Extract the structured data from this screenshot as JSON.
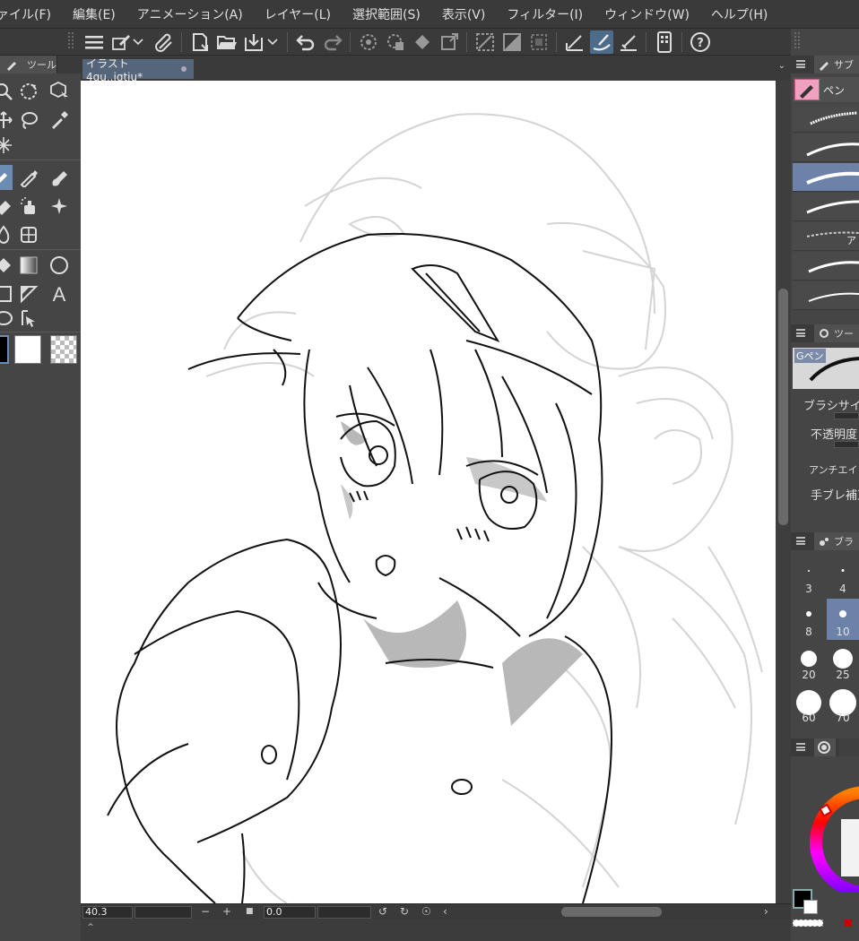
{
  "menu": [
    "ァイル(F)",
    "編集(E)",
    "アニメーション(A)",
    "レイヤー(L)",
    "選択範囲(S)",
    "表示(V)",
    "フィルター(I)",
    "ウィンドウ(W)",
    "ヘルプ(H)"
  ],
  "left_panel": {
    "tab_label": "ツール"
  },
  "document": {
    "tab_title": "イラスト4gu,.jgtju*"
  },
  "status": {
    "zoom": "40.3",
    "rotation": "0.0"
  },
  "right_panel": {
    "subtool_tab": "サブ",
    "subtool_group": "ペン",
    "subtool_partial_label": "ア",
    "tool_property_tab": "ツー",
    "tool_property_name": "Gペン",
    "properties": [
      "ブラシサイ",
      "不透明度",
      "アンチエイリア",
      "手ブレ補正"
    ],
    "brush_size_tab": "ブラ",
    "brush_sizes": [
      "3",
      "4",
      "8",
      "10",
      "20",
      "25",
      "60",
      "70"
    ],
    "selected_brush_size": "10"
  },
  "colors": {
    "accent": "#6d82a8",
    "selected_tool": "#6d8cb4",
    "main_color": "#000000",
    "sub_color": "#ffffff"
  }
}
